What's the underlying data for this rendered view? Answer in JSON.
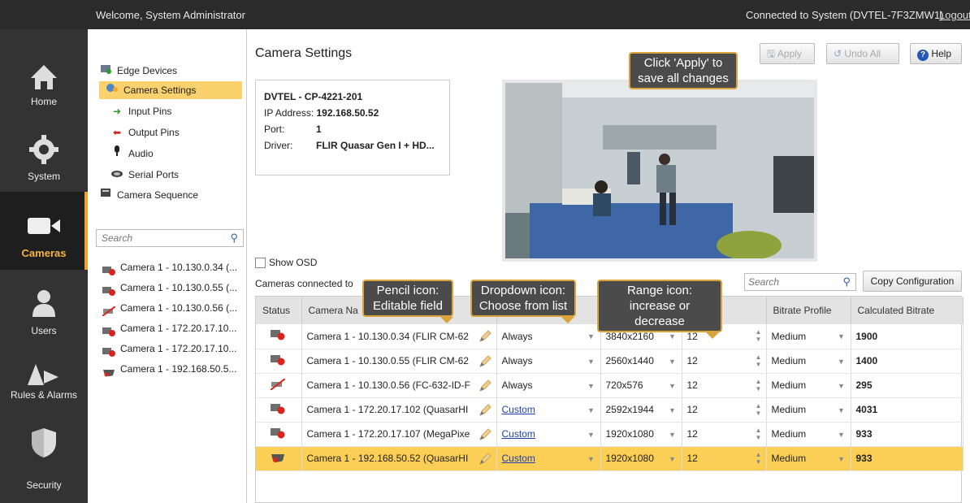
{
  "topbar": {
    "welcome": "Welcome, System Administrator",
    "connection": "Connected to System (DVTEL-7F3ZMW1)",
    "logout": "Logout"
  },
  "nav": {
    "items": [
      {
        "label": "Home",
        "icon": "home-icon"
      },
      {
        "label": "System",
        "icon": "gear-icon"
      },
      {
        "label": "Cameras",
        "icon": "camera-icon",
        "active": true
      },
      {
        "label": "Users",
        "icon": "user-icon"
      },
      {
        "label": "Rules & Alarms",
        "icon": "rules-alarms-icon"
      },
      {
        "label": "Security",
        "icon": "shield-icon"
      }
    ]
  },
  "tree": {
    "items": [
      {
        "label": "Edge Devices",
        "icon": "edge-devices-icon"
      },
      {
        "label": "Camera Settings",
        "icon": "camera-settings-icon",
        "selected": true
      },
      {
        "label": "Input Pins",
        "icon": "arrow-right-icon"
      },
      {
        "label": "Output Pins",
        "icon": "arrow-left-icon"
      },
      {
        "label": "Audio",
        "icon": "microphone-icon"
      },
      {
        "label": "Serial Ports",
        "icon": "serial-port-icon"
      },
      {
        "label": "Camera Sequence",
        "icon": "camera-sequence-icon"
      }
    ],
    "search_placeholder": "Search",
    "cameras": [
      "Camera 1 - 10.130.0.34 (...",
      "Camera 1 - 10.130.0.55 (...",
      "Camera 1 - 10.130.0.56 (...",
      "Camera 1 - 172.20.17.10...",
      "Camera 1 - 172.20.17.10...",
      "Camera 1 - 192.168.50.5..."
    ]
  },
  "main": {
    "title": "Camera Settings",
    "apply": "Apply",
    "undo_all": "Undo All",
    "help": "Help",
    "device": {
      "name": "DVTEL - CP-4221-201",
      "ip_label": "IP Address:",
      "ip": "192.168.50.52",
      "port_label": "Port:",
      "port": "1",
      "driver_label": "Driver:",
      "driver": "FLIR Quasar Gen I + HD..."
    },
    "show_osd": "Show OSD",
    "cameras_connected": "Cameras connected to",
    "search_placeholder": "Search",
    "copy_config": "Copy Configuration"
  },
  "table": {
    "headers": [
      "Status",
      "Camera Na",
      "",
      "",
      "",
      "Bitrate Profile",
      "Calculated Bitrate"
    ],
    "rows": [
      {
        "name": "Camera 1 - 10.130.0.34 (FLIR CM-62",
        "schedule": "Always",
        "resolution": "3840x2160",
        "fps": "12",
        "profile": "Medium",
        "bitrate": "1900",
        "status": "camera-red-icon"
      },
      {
        "name": "Camera 1 - 10.130.0.55 (FLIR CM-62",
        "schedule": "Always",
        "resolution": "2560x1440",
        "fps": "12",
        "profile": "Medium",
        "bitrate": "1400",
        "status": "camera-red-icon"
      },
      {
        "name": "Camera 1 - 10.130.0.56 (FC-632-ID-F",
        "schedule": "Always",
        "resolution": "720x576",
        "fps": "12",
        "profile": "Medium",
        "bitrate": "295",
        "status": "camera-disabled-icon"
      },
      {
        "name": "Camera 1 - 172.20.17.102 (QuasarHI",
        "schedule": "Custom",
        "resolution": "2592x1944",
        "fps": "12",
        "profile": "Medium",
        "bitrate": "4031",
        "status": "camera-red-icon"
      },
      {
        "name": "Camera 1 - 172.20.17.107 (MegaPixe",
        "schedule": "Custom",
        "resolution": "1920x1080",
        "fps": "12",
        "profile": "Medium",
        "bitrate": "933",
        "status": "camera-red-icon"
      },
      {
        "name": "Camera 1 - 192.168.50.52 (QuasarHI",
        "schedule": "Custom",
        "resolution": "1920x1080",
        "fps": "12",
        "profile": "Medium",
        "bitrate": "933",
        "status": "dome-camera-icon",
        "selected": true
      }
    ]
  },
  "tips": {
    "apply": "Click 'Apply' to\nsave all changes",
    "pencil": "Pencil icon:\nEditable field",
    "dropdown": "Dropdown icon:\nChoose from list",
    "range": "Range icon:\nincrease or decrease"
  },
  "colors": {
    "accent": "#f0a526",
    "selected_row": "#fbcf55",
    "tooltip_bg": "#4b4b4b"
  }
}
